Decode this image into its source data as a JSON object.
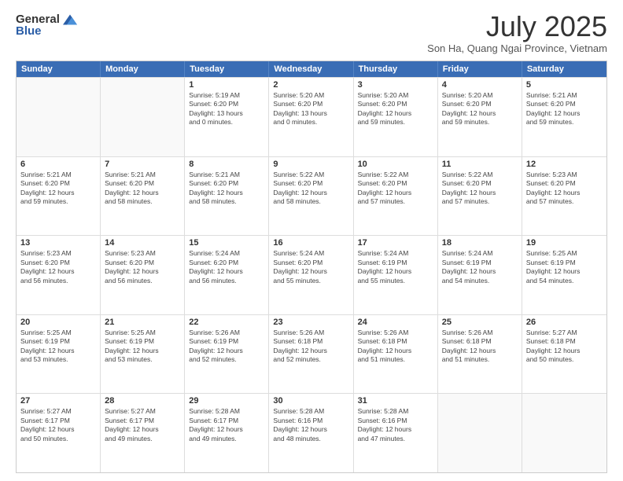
{
  "logo": {
    "general": "General",
    "blue": "Blue"
  },
  "title": "July 2025",
  "subtitle": "Son Ha, Quang Ngai Province, Vietnam",
  "headers": [
    "Sunday",
    "Monday",
    "Tuesday",
    "Wednesday",
    "Thursday",
    "Friday",
    "Saturday"
  ],
  "rows": [
    [
      {
        "day": "",
        "info": ""
      },
      {
        "day": "",
        "info": ""
      },
      {
        "day": "1",
        "info": "Sunrise: 5:19 AM\nSunset: 6:20 PM\nDaylight: 13 hours\nand 0 minutes."
      },
      {
        "day": "2",
        "info": "Sunrise: 5:20 AM\nSunset: 6:20 PM\nDaylight: 13 hours\nand 0 minutes."
      },
      {
        "day": "3",
        "info": "Sunrise: 5:20 AM\nSunset: 6:20 PM\nDaylight: 12 hours\nand 59 minutes."
      },
      {
        "day": "4",
        "info": "Sunrise: 5:20 AM\nSunset: 6:20 PM\nDaylight: 12 hours\nand 59 minutes."
      },
      {
        "day": "5",
        "info": "Sunrise: 5:21 AM\nSunset: 6:20 PM\nDaylight: 12 hours\nand 59 minutes."
      }
    ],
    [
      {
        "day": "6",
        "info": "Sunrise: 5:21 AM\nSunset: 6:20 PM\nDaylight: 12 hours\nand 59 minutes."
      },
      {
        "day": "7",
        "info": "Sunrise: 5:21 AM\nSunset: 6:20 PM\nDaylight: 12 hours\nand 58 minutes."
      },
      {
        "day": "8",
        "info": "Sunrise: 5:21 AM\nSunset: 6:20 PM\nDaylight: 12 hours\nand 58 minutes."
      },
      {
        "day": "9",
        "info": "Sunrise: 5:22 AM\nSunset: 6:20 PM\nDaylight: 12 hours\nand 58 minutes."
      },
      {
        "day": "10",
        "info": "Sunrise: 5:22 AM\nSunset: 6:20 PM\nDaylight: 12 hours\nand 57 minutes."
      },
      {
        "day": "11",
        "info": "Sunrise: 5:22 AM\nSunset: 6:20 PM\nDaylight: 12 hours\nand 57 minutes."
      },
      {
        "day": "12",
        "info": "Sunrise: 5:23 AM\nSunset: 6:20 PM\nDaylight: 12 hours\nand 57 minutes."
      }
    ],
    [
      {
        "day": "13",
        "info": "Sunrise: 5:23 AM\nSunset: 6:20 PM\nDaylight: 12 hours\nand 56 minutes."
      },
      {
        "day": "14",
        "info": "Sunrise: 5:23 AM\nSunset: 6:20 PM\nDaylight: 12 hours\nand 56 minutes."
      },
      {
        "day": "15",
        "info": "Sunrise: 5:24 AM\nSunset: 6:20 PM\nDaylight: 12 hours\nand 56 minutes."
      },
      {
        "day": "16",
        "info": "Sunrise: 5:24 AM\nSunset: 6:20 PM\nDaylight: 12 hours\nand 55 minutes."
      },
      {
        "day": "17",
        "info": "Sunrise: 5:24 AM\nSunset: 6:19 PM\nDaylight: 12 hours\nand 55 minutes."
      },
      {
        "day": "18",
        "info": "Sunrise: 5:24 AM\nSunset: 6:19 PM\nDaylight: 12 hours\nand 54 minutes."
      },
      {
        "day": "19",
        "info": "Sunrise: 5:25 AM\nSunset: 6:19 PM\nDaylight: 12 hours\nand 54 minutes."
      }
    ],
    [
      {
        "day": "20",
        "info": "Sunrise: 5:25 AM\nSunset: 6:19 PM\nDaylight: 12 hours\nand 53 minutes."
      },
      {
        "day": "21",
        "info": "Sunrise: 5:25 AM\nSunset: 6:19 PM\nDaylight: 12 hours\nand 53 minutes."
      },
      {
        "day": "22",
        "info": "Sunrise: 5:26 AM\nSunset: 6:19 PM\nDaylight: 12 hours\nand 52 minutes."
      },
      {
        "day": "23",
        "info": "Sunrise: 5:26 AM\nSunset: 6:18 PM\nDaylight: 12 hours\nand 52 minutes."
      },
      {
        "day": "24",
        "info": "Sunrise: 5:26 AM\nSunset: 6:18 PM\nDaylight: 12 hours\nand 51 minutes."
      },
      {
        "day": "25",
        "info": "Sunrise: 5:26 AM\nSunset: 6:18 PM\nDaylight: 12 hours\nand 51 minutes."
      },
      {
        "day": "26",
        "info": "Sunrise: 5:27 AM\nSunset: 6:18 PM\nDaylight: 12 hours\nand 50 minutes."
      }
    ],
    [
      {
        "day": "27",
        "info": "Sunrise: 5:27 AM\nSunset: 6:17 PM\nDaylight: 12 hours\nand 50 minutes."
      },
      {
        "day": "28",
        "info": "Sunrise: 5:27 AM\nSunset: 6:17 PM\nDaylight: 12 hours\nand 49 minutes."
      },
      {
        "day": "29",
        "info": "Sunrise: 5:28 AM\nSunset: 6:17 PM\nDaylight: 12 hours\nand 49 minutes."
      },
      {
        "day": "30",
        "info": "Sunrise: 5:28 AM\nSunset: 6:16 PM\nDaylight: 12 hours\nand 48 minutes."
      },
      {
        "day": "31",
        "info": "Sunrise: 5:28 AM\nSunset: 6:16 PM\nDaylight: 12 hours\nand 47 minutes."
      },
      {
        "day": "",
        "info": ""
      },
      {
        "day": "",
        "info": ""
      }
    ]
  ]
}
